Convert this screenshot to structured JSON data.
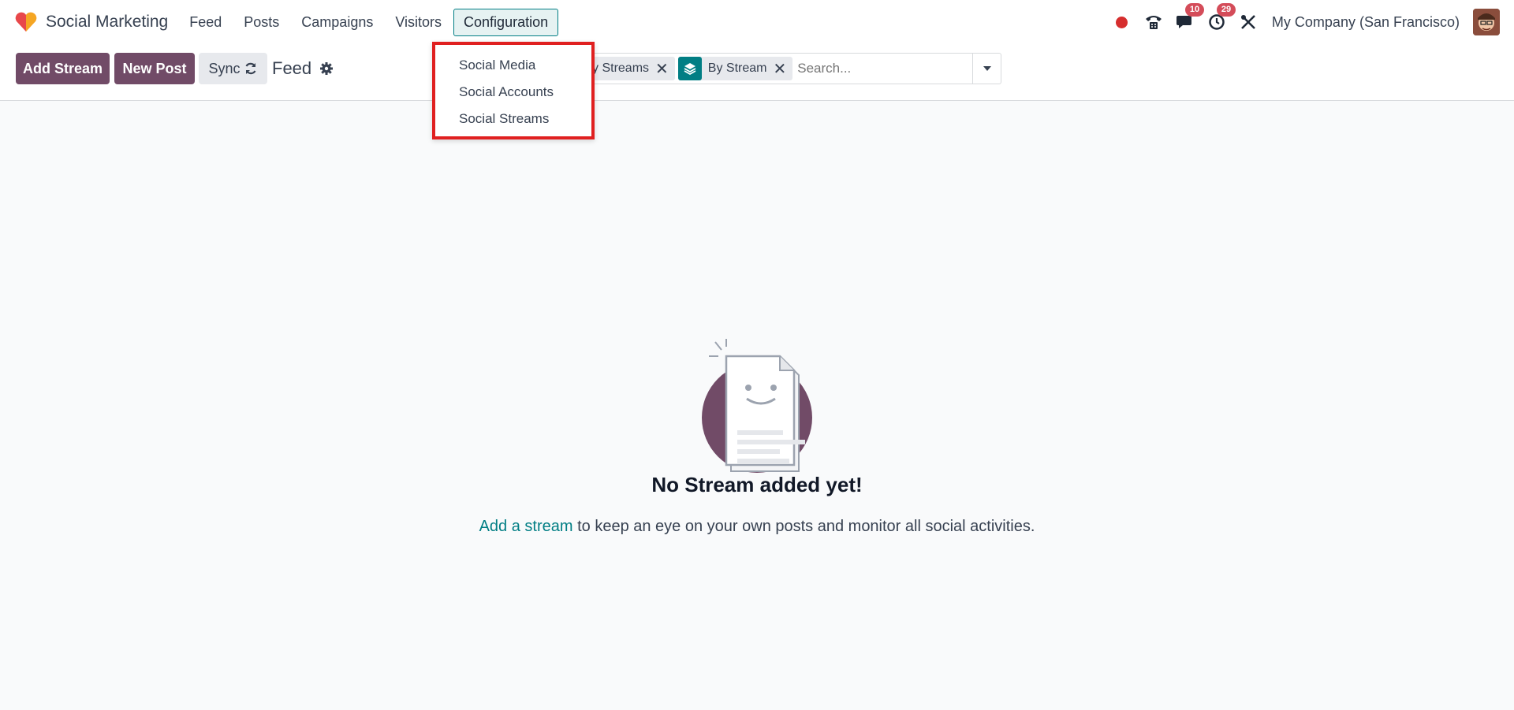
{
  "app": {
    "name": "Social Marketing"
  },
  "menu": {
    "items": [
      "Feed",
      "Posts",
      "Campaigns",
      "Visitors",
      "Configuration"
    ],
    "active": "Configuration"
  },
  "systray": {
    "messages_count": "10",
    "activities_count": "29",
    "company": "My Company (San Francisco)"
  },
  "toolbar": {
    "add_stream_label": "Add Stream",
    "new_post_label": "New Post",
    "sync_label": "Sync",
    "breadcrumb": "Feed"
  },
  "search": {
    "facets": [
      {
        "label": "y Streams"
      },
      {
        "label": "By Stream"
      }
    ],
    "placeholder": "Search..."
  },
  "dropdown": {
    "items": [
      "Social Media",
      "Social Accounts",
      "Social Streams"
    ]
  },
  "empty_state": {
    "title": "No Stream added yet!",
    "link_text": "Add a stream",
    "text_rest": " to keep an eye on your own posts and monitor all social activities."
  },
  "colors": {
    "brand": "#714b67",
    "accent": "#017e84",
    "highlight": "#e02020"
  }
}
